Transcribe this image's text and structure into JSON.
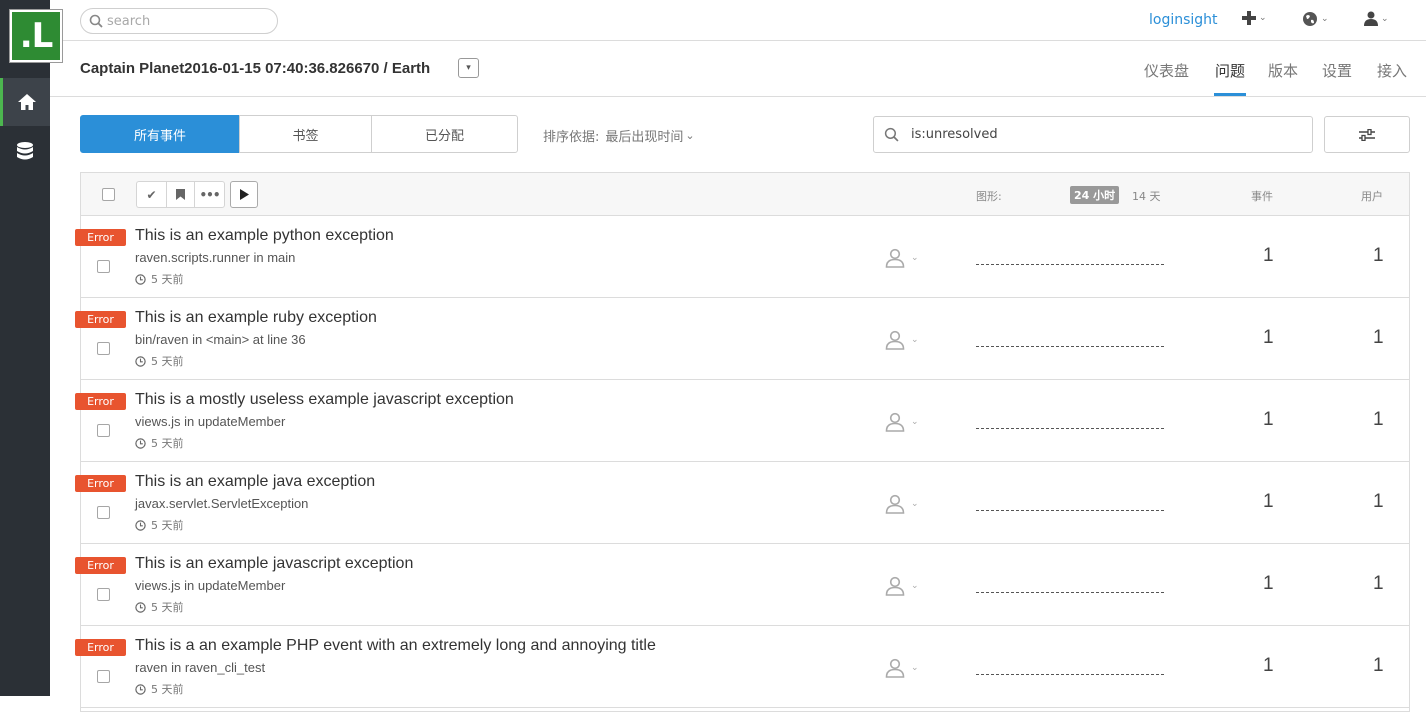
{
  "logo": {
    "text": ".L"
  },
  "sidebar": {
    "items": [
      {
        "name": "home",
        "icon": "home-icon"
      },
      {
        "name": "database",
        "icon": "database-icon"
      }
    ]
  },
  "topbar": {
    "search_placeholder": "search",
    "user_link": "loginsight",
    "actions": [
      "plus-icon",
      "globe-icon",
      "user-icon"
    ]
  },
  "project": {
    "title": "Captain Planet2016-01-15 07:40:36.826670 / Earth",
    "tabs": [
      "仪表盘",
      "问题",
      "版本",
      "设置",
      "接入"
    ],
    "active_tab": "问题"
  },
  "filters": {
    "segments": [
      "所有事件",
      "书签",
      "已分配"
    ],
    "active_segment": "所有事件",
    "sort_label": "排序依据:",
    "sort_value": "最后出现时间",
    "query": "is:unresolved"
  },
  "table_header": {
    "graph_label": "图形:",
    "range_24h": "24 小时",
    "range_14d": "14 天",
    "events_label": "事件",
    "users_label": "用户"
  },
  "issues": [
    {
      "level": "Error",
      "title": "This is an example python exception",
      "culprit": "raven.scripts.runner in main",
      "time": "5 天前",
      "events": "1",
      "users": "1"
    },
    {
      "level": "Error",
      "title": "This is an example ruby exception",
      "culprit": "bin/raven in <main> at line 36",
      "time": "5 天前",
      "events": "1",
      "users": "1"
    },
    {
      "level": "Error",
      "title": "This is a mostly useless example javascript exception",
      "culprit": "views.js in updateMember",
      "time": "5 天前",
      "events": "1",
      "users": "1"
    },
    {
      "level": "Error",
      "title": "This is an example java exception",
      "culprit": "javax.servlet.ServletException",
      "time": "5 天前",
      "events": "1",
      "users": "1"
    },
    {
      "level": "Error",
      "title": "This is an example javascript exception",
      "culprit": "views.js in updateMember",
      "time": "5 天前",
      "events": "1",
      "users": "1"
    },
    {
      "level": "Error",
      "title": "This is a an example PHP event with an extremely long and annoying title",
      "culprit": "raven in raven_cli_test",
      "time": "5 天前",
      "events": "1",
      "users": "1"
    }
  ]
}
